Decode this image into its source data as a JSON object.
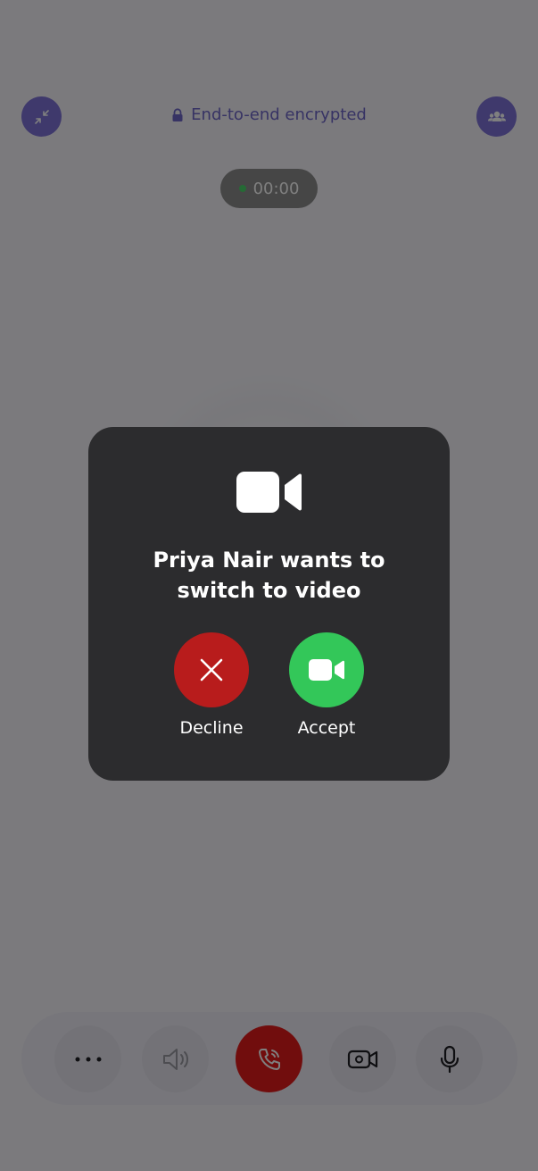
{
  "header": {
    "encryption_label": "End-to-end encrypted",
    "left_button_icon": "collapse-arrows-icon",
    "right_button_icon": "participants-icon"
  },
  "call": {
    "timer": "00:00"
  },
  "dialog": {
    "icon": "video-camera-icon",
    "message": "Priya Nair wants to switch to video",
    "decline_label": "Decline",
    "accept_label": "Accept"
  },
  "controls": {
    "items": [
      {
        "icon": "more-options-icon"
      },
      {
        "icon": "speaker-icon"
      },
      {
        "icon": "end-call-icon"
      },
      {
        "icon": "video-toggle-icon"
      },
      {
        "icon": "microphone-icon"
      }
    ]
  },
  "colors": {
    "accent": "#7e72d8",
    "decline": "#b81c1c",
    "accept": "#33c759",
    "end_call": "#e21a1a",
    "modal_bg": "#2c2c2e"
  }
}
